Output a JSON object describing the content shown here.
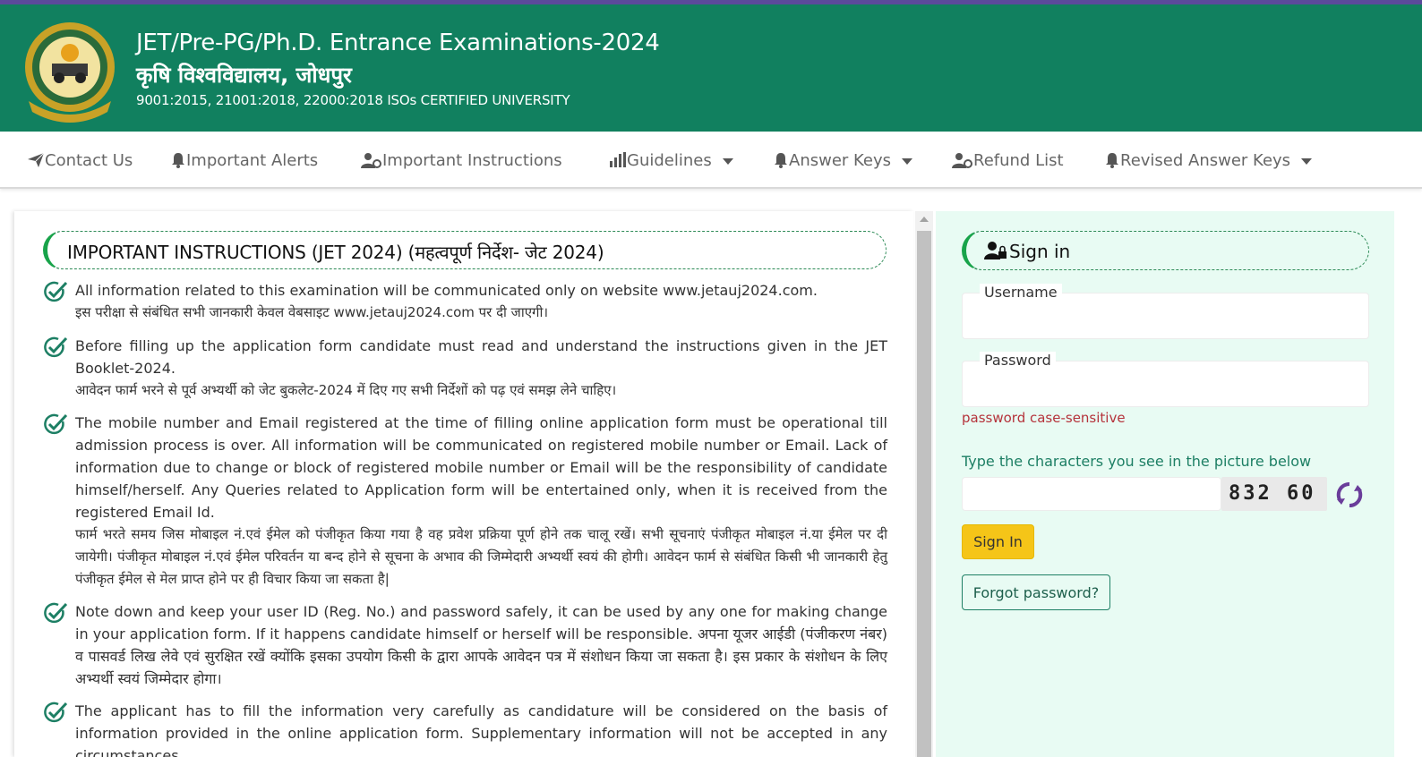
{
  "header": {
    "title": "JET/Pre-PG/Ph.D. Entrance Examinations-2024",
    "subtitle": "कृषि विश्वविद्यालय, जोधपुर",
    "iso": "9001:2015, 21001:2018, 22000:2018 ISOs CERTIFIED UNIVERSITY",
    "logo_icon": "university-seal-icon",
    "colors": {
      "header_bg": "#11805f",
      "top_strip": "#5b4a9b"
    }
  },
  "nav": {
    "items": [
      {
        "label": "Contact Us",
        "icon": "paper-plane-icon",
        "dropdown": false
      },
      {
        "label": "Important Alerts",
        "icon": "bell-icon",
        "dropdown": false
      },
      {
        "label": "Important Instructions",
        "icon": "user-gear-icon",
        "dropdown": false
      },
      {
        "label": "Guidelines",
        "icon": "bar-chart-icon",
        "dropdown": true
      },
      {
        "label": "Answer Keys",
        "icon": "bell-icon",
        "dropdown": true
      },
      {
        "label": "Refund List",
        "icon": "user-gear-icon",
        "dropdown": false
      },
      {
        "label": "Revised Answer Keys",
        "icon": "bell-icon",
        "dropdown": true
      }
    ]
  },
  "instructions": {
    "heading": "IMPORTANT INSTRUCTIONS (JET 2024) (महत्वपूर्ण निर्देश- जेट 2024)",
    "items": [
      {
        "en": "All information related to this examination will be communicated only on website www.jetauj2024.com.",
        "hi": "इस परीक्षा से संबंधित सभी जानकारी केवल वेबसाइट www.jetauj2024.com पर दी जाएगी।"
      },
      {
        "en": "Before filling up the application form candidate must read and understand the instructions given in the JET Booklet-2024.",
        "hi": "आवेदन फार्म भरने से पूर्व अभ्यर्थी को जेट बुकलेट-2024 में दिए गए सभी निर्देशों को पढ़ एवं समझ लेने चाहिए।"
      },
      {
        "en": "The mobile number and Email registered at the time of filling online application form must be operational till admission process is over. All information will be communicated on registered mobile number or Email. Lack of information due to change or block of registered mobile number or Email will be the responsibility of candidate himself/herself. Any Queries related to Application form will be entertained only, when it is received from the registered Email Id.",
        "hi": "फार्म भरते समय जिस मोबाइल नं.एवं ईमेल को पंजीकृत किया गया है वह प्रवेश प्रक्रिया पूर्ण होने तक चालू रखें। सभी सूचनाएं पंजीकृत मोबाइल नं.या ईमेल पर दी जायेगी। पंजीकृत मोबाइल नं.एवं ईमेल परिवर्तन या बन्द होने से सूचना के अभाव की जिम्मेदारी अभ्यर्थी स्वयं की होगी। आवेदन फार्म से संबंधित किसी भी जानकारी हेतु पंजीकृत ईमेल से मेल प्राप्त होने पर ही विचार किया जा सकता है|"
      },
      {
        "en": "Note down and keep your user ID (Reg. No.) and password safely, it can be used by any one for making change in your application form. If it happens candidate himself or herself will be responsible. अपना यूजर आईडी (पंजीकरण नंबर) व पासवर्ड लिख लेवे एवं सुरक्षित रखें क्योंकि इसका उपयोग किसी के द्वारा आपके आवेदन पत्र में संशोधन किया जा सकता है। इस प्रकार के संशोधन के लिए अभ्यर्थी स्वयं जिम्मेदार होगा।",
        "hi": ""
      },
      {
        "en": "The applicant has to fill the information very carefully as candidature will be considered on the basis of information provided in the online application form. Supplementary information will not be accepted in any circumstances.",
        "hi": ""
      }
    ]
  },
  "signin": {
    "heading": "Sign in",
    "username_label": "Username",
    "username_value": "",
    "password_label": "Password",
    "password_value": "",
    "password_hint": "password case-sensitive",
    "captcha_label": "Type the characters you see in the picture below",
    "captcha_value": "",
    "captcha_text": "832 60",
    "signin_button": "Sign In",
    "forgot_button": "Forgot password?",
    "colors": {
      "panel_bg": "#e8fbf3",
      "signin_button": "#f5c518",
      "hint": "#b5333b",
      "accent": "#1d7f64"
    }
  }
}
